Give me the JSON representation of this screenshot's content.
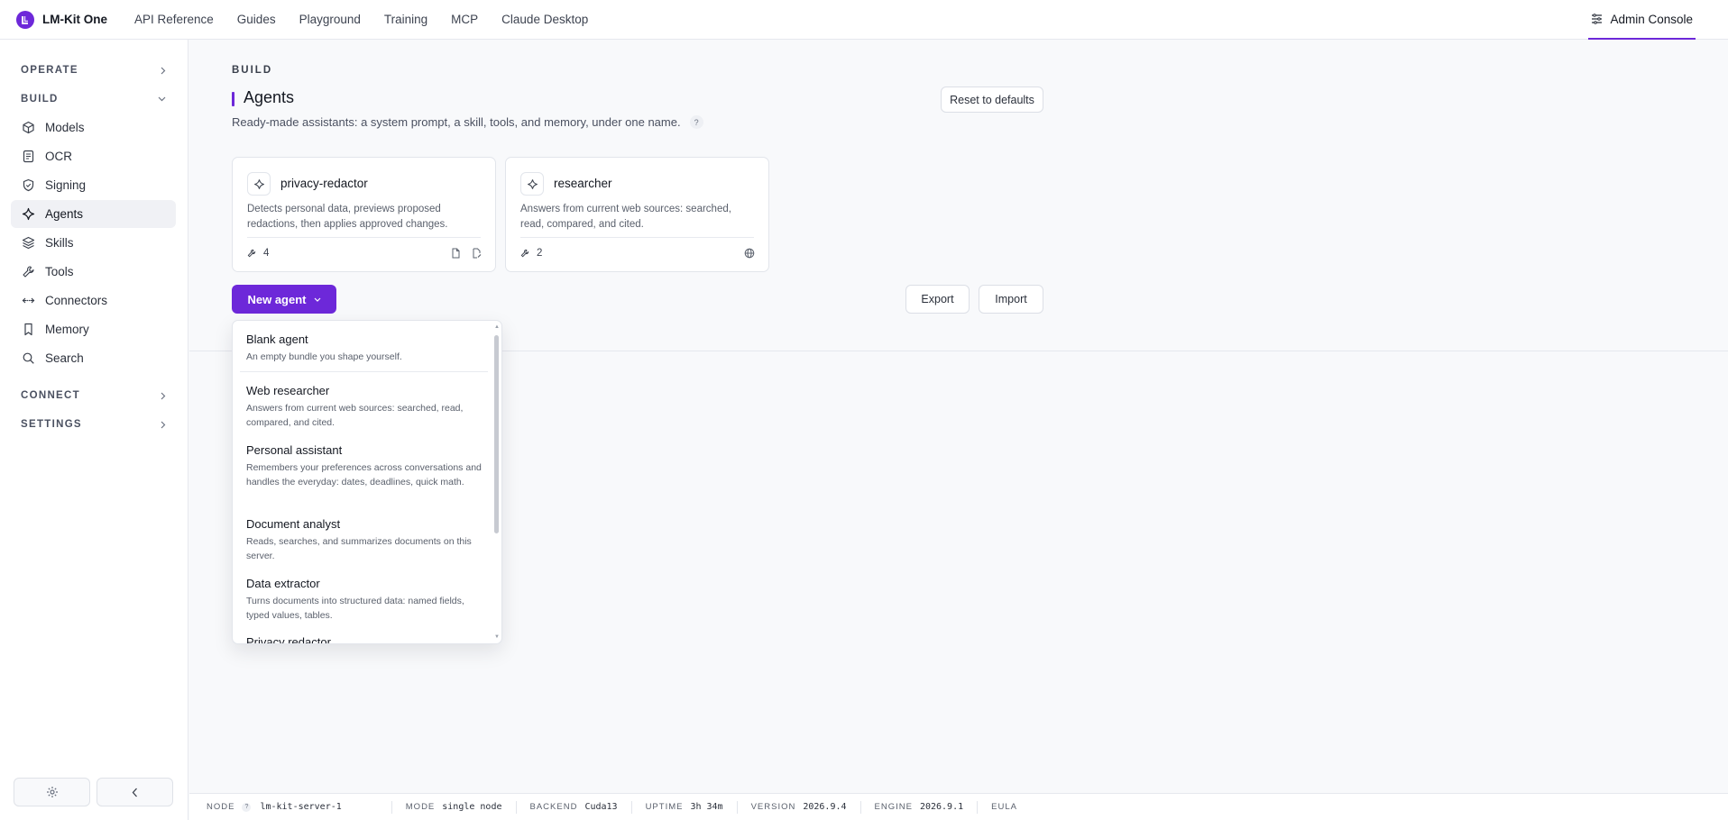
{
  "brand": {
    "name": "LM-Kit One"
  },
  "topnav": [
    "API Reference",
    "Guides",
    "Playground",
    "Training",
    "MCP",
    "Claude Desktop"
  ],
  "admin_console": "Admin Console",
  "sidebar": {
    "sections": {
      "operate": "OPERATE",
      "build": "BUILD",
      "connect": "CONNECT",
      "settings": "SETTINGS"
    },
    "items": [
      {
        "label": "Models",
        "icon": "cube-icon"
      },
      {
        "label": "OCR",
        "icon": "document-scan-icon"
      },
      {
        "label": "Signing",
        "icon": "shield-icon"
      },
      {
        "label": "Agents",
        "icon": "sparkle-icon",
        "active": true
      },
      {
        "label": "Skills",
        "icon": "layers-icon"
      },
      {
        "label": "Tools",
        "icon": "wrench-icon"
      },
      {
        "label": "Connectors",
        "icon": "connector-icon"
      },
      {
        "label": "Memory",
        "icon": "bookmark-icon"
      },
      {
        "label": "Search",
        "icon": "search-icon"
      }
    ]
  },
  "page": {
    "eyebrow": "BUILD",
    "title": "Agents",
    "subtitle": "Ready-made assistants: a system prompt, a skill, tools, and memory, under one name.",
    "help": "?",
    "reset_label": "Reset to defaults",
    "export_label": "Export",
    "import_label": "Import",
    "new_agent_label": "New agent"
  },
  "agents": [
    {
      "name": "privacy-redactor",
      "description": "Detects personal data, previews proposed redactions, then applies approved changes.",
      "tool_count": "4"
    },
    {
      "name": "researcher",
      "description": "Answers from current web sources: searched, read, compared, and cited.",
      "tool_count": "2"
    }
  ],
  "templates": [
    {
      "title": "Blank agent",
      "description": "An empty bundle you shape yourself."
    },
    {
      "title": "Web researcher",
      "description": "Answers from current web sources: searched, read, compared, and cited."
    },
    {
      "title": "Personal assistant",
      "description": "Remembers your preferences across conversations and handles the everyday: dates, deadlines, quick math."
    },
    {
      "title": "Document analyst",
      "description": "Reads, searches, and summarizes documents on this server."
    },
    {
      "title": "Data extractor",
      "description": "Turns documents into structured data: named fields, typed values, tables."
    },
    {
      "title": "Privacy redactor",
      "description": ""
    }
  ],
  "footer": {
    "node_label": "NODE",
    "node_help": "?",
    "node_value": "lm-kit-server-1",
    "mode_label": "MODE",
    "mode_value": "single node",
    "backend_label": "BACKEND",
    "backend_value": "Cuda13",
    "uptime_label": "UPTIME",
    "uptime_value": "3h 34m",
    "version_label": "VERSION",
    "version_value": "2026.9.4",
    "engine_label": "ENGINE",
    "engine_value": "2026.9.1",
    "eula_label": "EULA"
  },
  "colors": {
    "accent": "#6d28d9",
    "background": "#f8f9fb",
    "surface": "#ffffff",
    "border": "#e2e5eb"
  }
}
